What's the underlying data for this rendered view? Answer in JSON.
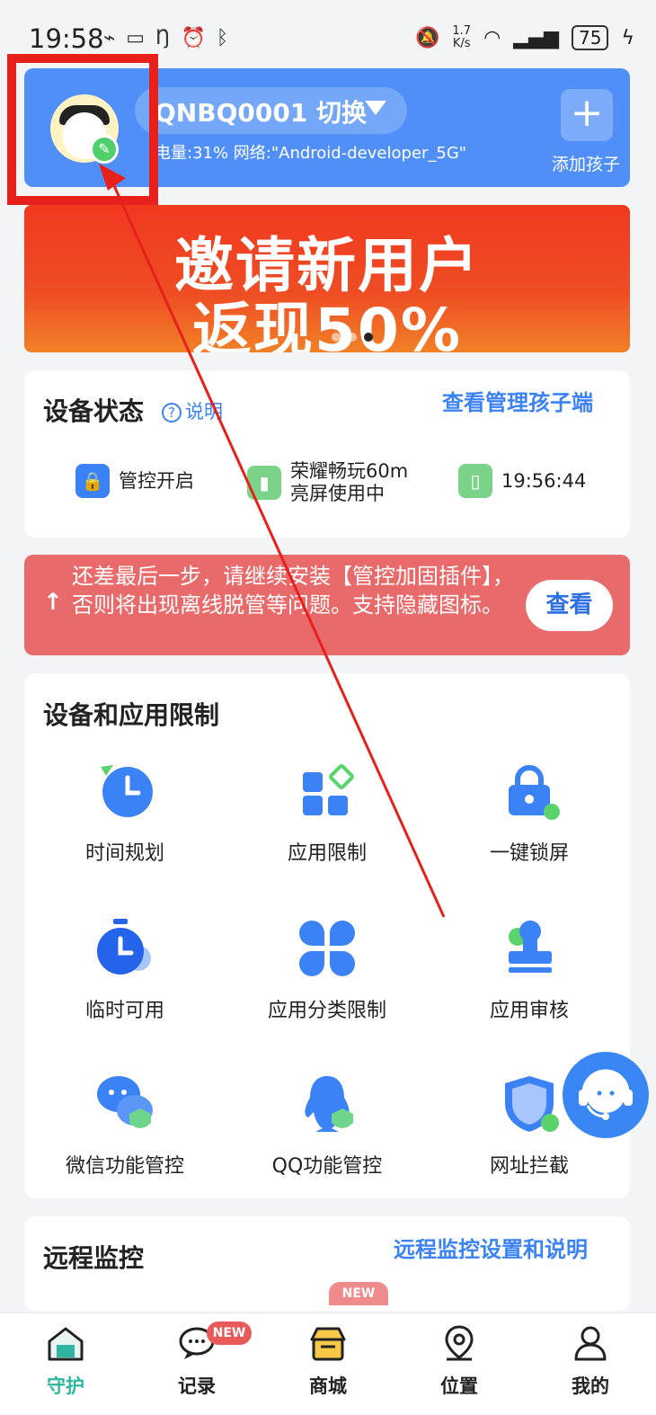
{
  "status_bar": {
    "time": "19:58",
    "network_speed_value": "1.7",
    "network_speed_unit": "K/s",
    "battery": "75"
  },
  "header": {
    "device_name": "QNBQ0001 切换",
    "device_info": "电量:31% 网络:\"Android-developer_5G\"",
    "add_child_label": "添加孩子"
  },
  "banner": {
    "line1": "邀请新用户",
    "line2": "返现50%"
  },
  "device_status": {
    "title": "设备状态",
    "help_label": "说明",
    "view_child_link": "查看管理孩子端",
    "items": [
      {
        "label": "管控开启",
        "icon": "lock-icon",
        "color": "#3b82f6"
      },
      {
        "label": "荣耀畅玩60m\n亮屏使用中",
        "line1": "荣耀畅玩60m",
        "line2": "亮屏使用中",
        "icon": "signal-icon",
        "color": "#7bd389"
      },
      {
        "label": "19:56:44",
        "icon": "tablet-icon",
        "color": "#7bd389"
      }
    ]
  },
  "alert": {
    "text": "还差最后一步，请继续安装【管控加固插件】，否则将出现离线脱管等问题。支持隐藏图标。",
    "button_label": "查看"
  },
  "restrictions": {
    "title": "设备和应用限制",
    "items": [
      {
        "label": "时间规划",
        "icon": "clock-icon"
      },
      {
        "label": "应用限制",
        "icon": "app-grid-icon"
      },
      {
        "label": "一键锁屏",
        "icon": "lock-icon"
      },
      {
        "label": "临时可用",
        "icon": "stopwatch-icon"
      },
      {
        "label": "应用分类限制",
        "icon": "category-icon"
      },
      {
        "label": "应用审核",
        "icon": "stamp-icon"
      },
      {
        "label": "微信功能管控",
        "icon": "wechat-icon"
      },
      {
        "label": "QQ功能管控",
        "icon": "qq-icon"
      },
      {
        "label": "网址拦截",
        "icon": "shield-icon"
      }
    ]
  },
  "remote": {
    "title": "远程监控",
    "settings_link": "远程监控设置和说明",
    "new_tag": "NEW"
  },
  "bottom_nav": {
    "items": [
      {
        "label": "守护",
        "icon": "home-icon",
        "active": true
      },
      {
        "label": "记录",
        "icon": "chat-icon",
        "active": false
      },
      {
        "label": "商城",
        "icon": "shop-icon",
        "active": false
      },
      {
        "label": "位置",
        "icon": "location-icon",
        "active": false
      },
      {
        "label": "我的",
        "icon": "profile-icon",
        "active": false
      }
    ],
    "new_badge": "NEW"
  },
  "colors": {
    "primary_blue": "#4f8ff7",
    "link_blue": "#3b82f6",
    "alert_red": "#e86a6a",
    "annotation_red": "#e8201c",
    "active_tab": "#2fb6a0"
  }
}
